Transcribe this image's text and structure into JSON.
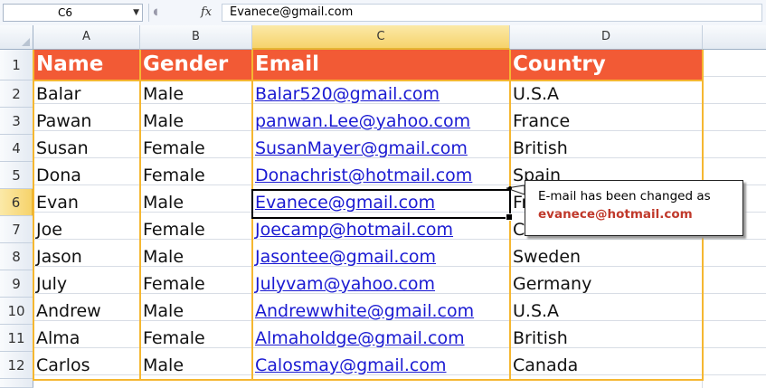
{
  "formula_bar": {
    "name_box": "C6",
    "fx_label": "fx",
    "formula": "Evanece@gmail.com"
  },
  "columns": [
    "A",
    "B",
    "C",
    "D"
  ],
  "rows": [
    "1",
    "2",
    "3",
    "4",
    "5",
    "6",
    "7",
    "8",
    "9",
    "10",
    "11",
    "12"
  ],
  "selected_cell": "C6",
  "headers": {
    "name": "Name",
    "gender": "Gender",
    "email": "Email",
    "country": "Country"
  },
  "records": [
    {
      "name": "Balar",
      "gender": "Male",
      "email": "Balar520@gmail.com",
      "country": "U.S.A"
    },
    {
      "name": "Pawan",
      "gender": "Male",
      "email": "panwan.Lee@yahoo.com",
      "country": "France"
    },
    {
      "name": "Susan",
      "gender": "Female",
      "email": "SusanMayer@gmail.com",
      "country": "British"
    },
    {
      "name": "Dona",
      "gender": "Female",
      "email": "Donachrist@hotmail.com",
      "country": "Spain"
    },
    {
      "name": "Evan",
      "gender": "Male",
      "email": "Evanece@gmail.com",
      "country": "France"
    },
    {
      "name": "Joe",
      "gender": "Female",
      "email": "Joecamp@hotmail.com",
      "country": "Canada"
    },
    {
      "name": "Jason",
      "gender": "Male",
      "email": "Jasontee@gmail.com",
      "country": "Sweden"
    },
    {
      "name": "July",
      "gender": "Female",
      "email": "Julyvam@yahoo.com",
      "country": "Germany"
    },
    {
      "name": "Andrew",
      "gender": "Male",
      "email": "Andrewwhite@gmail.com",
      "country": "U.S.A"
    },
    {
      "name": "Alma",
      "gender": "Female",
      "email": "Almaholdge@gmail.com",
      "country": "British"
    },
    {
      "name": "Carlos",
      "gender": "Male",
      "email": "Calosmay@gmail.com",
      "country": "Canada"
    }
  ],
  "callout": {
    "line1": "E-mail has been changed as",
    "line2": "evanece@hotmail.com"
  },
  "colors": {
    "header_fill": "#f25a35",
    "border": "#f5b731",
    "link": "#1a1ad2",
    "callout_highlight": "#c0392b"
  }
}
